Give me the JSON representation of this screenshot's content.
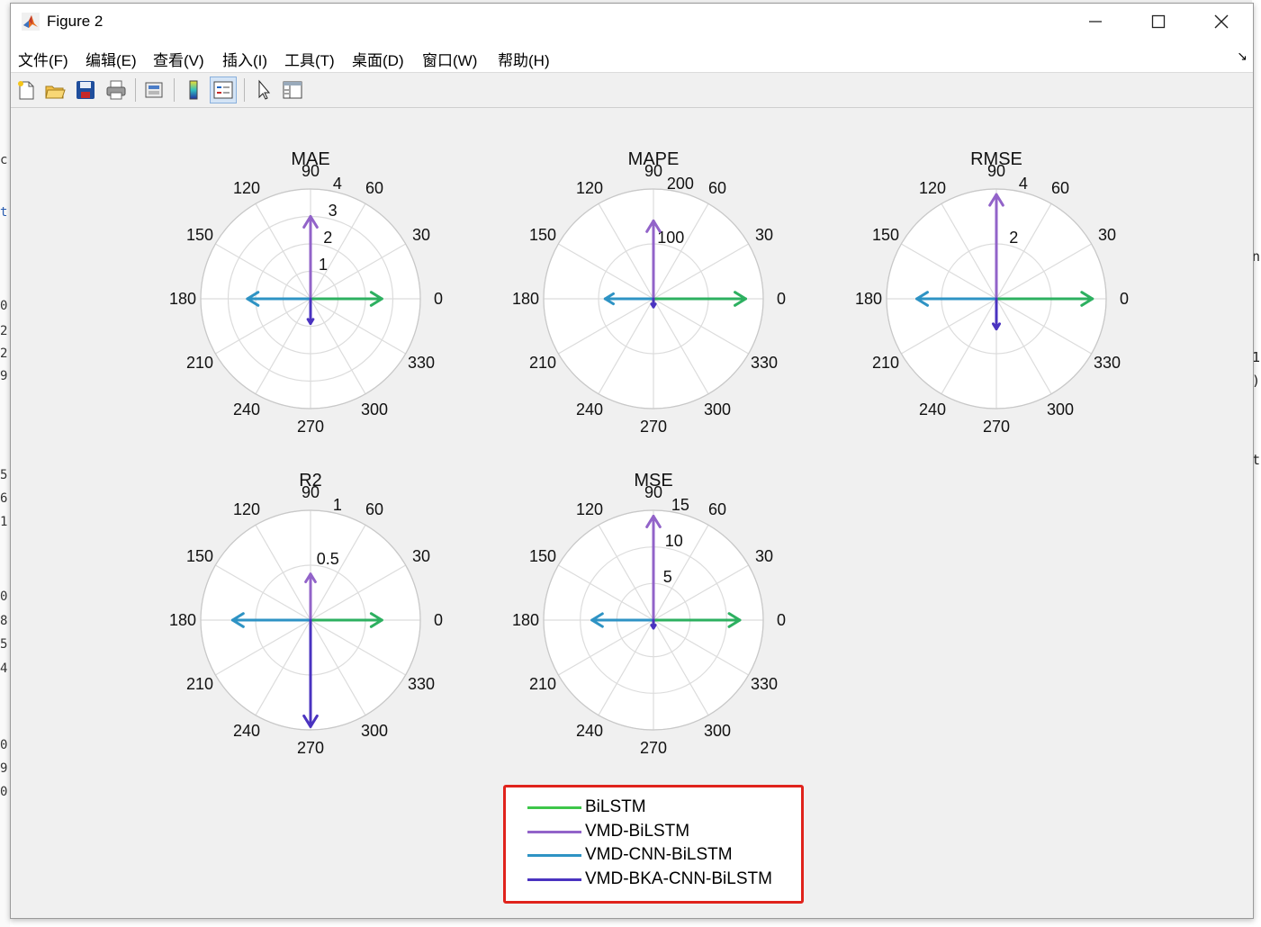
{
  "window": {
    "title": "Figure 2"
  },
  "menu": [
    "文件(F)",
    "编辑(E)",
    "查看(V)",
    "插入(I)",
    "工具(T)",
    "桌面(D)",
    "窗口(W)",
    "帮助(H)"
  ],
  "toolbar": {
    "buttons": [
      "new-figure-icon",
      "open-file-icon",
      "save-icon",
      "print-icon",
      "print-preview-icon",
      "colorbar-icon",
      "legend-icon",
      "pointer-icon",
      "property-inspector-icon"
    ],
    "pressed": "legend-icon"
  },
  "colors": {
    "BiLSTM": "#2db060",
    "VMD-BiLSTM": "#9263c9",
    "VMD-CNN-BiLSTM": "#2e93c4",
    "VMD-BKA-CNN-BiLSTM": "#4a33c0",
    "legend_frame": "#e0231c"
  },
  "legend": {
    "items": [
      {
        "label": "BiLSTM",
        "color": "#3ec64a"
      },
      {
        "label": "VMD-BiLSTM",
        "color": "#9263c9"
      },
      {
        "label": "VMD-CNN-BiLSTM",
        "color": "#2e93c4"
      },
      {
        "label": "VMD-BKA-CNN-BiLSTM",
        "color": "#4a33c0"
      }
    ]
  },
  "chart_data": [
    {
      "type": "polar",
      "title": "MAE",
      "angle_ticks": [
        0,
        30,
        60,
        90,
        120,
        150,
        180,
        210,
        240,
        270,
        300,
        330
      ],
      "r_ticks": [
        1,
        2,
        3,
        4
      ],
      "r_max": 4,
      "series": [
        {
          "name": "BiLSTM",
          "angle": 0,
          "value": 2.6
        },
        {
          "name": "VMD-BiLSTM",
          "angle": 90,
          "value": 3.0
        },
        {
          "name": "VMD-CNN-BiLSTM",
          "angle": 180,
          "value": 2.3
        },
        {
          "name": "VMD-BKA-CNN-BiLSTM",
          "angle": 270,
          "value": 0.9
        }
      ]
    },
    {
      "type": "polar",
      "title": "MAPE",
      "angle_ticks": [
        0,
        30,
        60,
        90,
        120,
        150,
        180,
        210,
        240,
        270,
        300,
        330
      ],
      "r_ticks": [
        100,
        200
      ],
      "r_max": 200,
      "series": [
        {
          "name": "BiLSTM",
          "angle": 0,
          "value": 168
        },
        {
          "name": "VMD-BiLSTM",
          "angle": 90,
          "value": 142
        },
        {
          "name": "VMD-CNN-BiLSTM",
          "angle": 180,
          "value": 88
        },
        {
          "name": "VMD-BKA-CNN-BiLSTM",
          "angle": 270,
          "value": 15
        }
      ]
    },
    {
      "type": "polar",
      "title": "RMSE",
      "angle_ticks": [
        0,
        30,
        60,
        90,
        120,
        150,
        180,
        210,
        240,
        270,
        300,
        330
      ],
      "r_ticks": [
        2,
        4
      ],
      "r_max": 4,
      "series": [
        {
          "name": "BiLSTM",
          "angle": 0,
          "value": 3.5
        },
        {
          "name": "VMD-BiLSTM",
          "angle": 90,
          "value": 3.8
        },
        {
          "name": "VMD-CNN-BiLSTM",
          "angle": 180,
          "value": 2.9
        },
        {
          "name": "VMD-BKA-CNN-BiLSTM",
          "angle": 270,
          "value": 1.1
        }
      ]
    },
    {
      "type": "polar",
      "title": "R2",
      "angle_ticks": [
        0,
        30,
        60,
        90,
        120,
        150,
        180,
        210,
        240,
        270,
        300,
        330
      ],
      "r_ticks": [
        0.5,
        1
      ],
      "r_max": 1,
      "series": [
        {
          "name": "BiLSTM",
          "angle": 0,
          "value": 0.65
        },
        {
          "name": "VMD-BiLSTM",
          "angle": 90,
          "value": 0.42
        },
        {
          "name": "VMD-CNN-BiLSTM",
          "angle": 180,
          "value": 0.71
        },
        {
          "name": "VMD-BKA-CNN-BiLSTM",
          "angle": 270,
          "value": 0.97
        }
      ]
    },
    {
      "type": "polar",
      "title": "MSE",
      "angle_ticks": [
        0,
        30,
        60,
        90,
        120,
        150,
        180,
        210,
        240,
        270,
        300,
        330
      ],
      "r_ticks": [
        5,
        10,
        15
      ],
      "r_max": 15,
      "series": [
        {
          "name": "BiLSTM",
          "angle": 0,
          "value": 11.8
        },
        {
          "name": "VMD-BiLSTM",
          "angle": 90,
          "value": 14.2
        },
        {
          "name": "VMD-CNN-BiLSTM",
          "angle": 180,
          "value": 8.4
        },
        {
          "name": "VMD-BKA-CNN-BiLSTM",
          "angle": 270,
          "value": 1.1
        }
      ]
    }
  ]
}
